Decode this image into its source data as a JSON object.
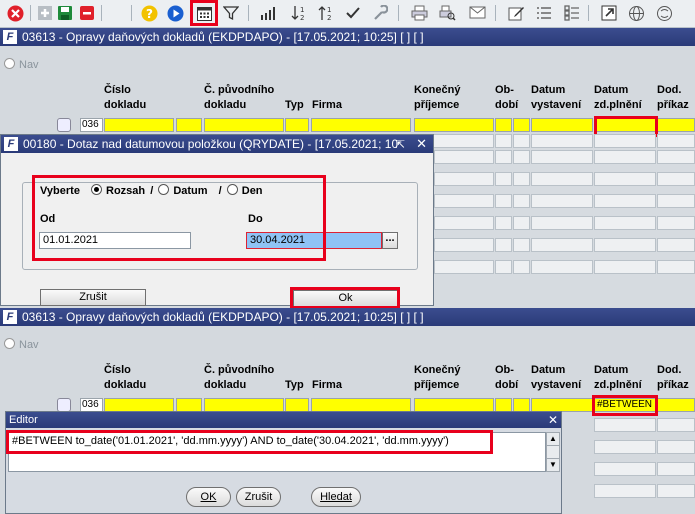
{
  "toolbar": {
    "icons": [
      "close-icon",
      "add-icon",
      "save-icon",
      "delete-icon",
      "help-icon",
      "play-icon",
      "calendar-icon",
      "filter-icon",
      "bar-chart-icon",
      "sort-desc-icon",
      "sort-asc-icon",
      "check-icon",
      "wrench-icon",
      "print-icon",
      "print-preview-icon",
      "mail-icon",
      "edit-icon",
      "list-icon",
      "checklist-icon",
      "export-icon",
      "globe-icon",
      "other-icon"
    ]
  },
  "window_top": {
    "title": "03613 - Opravy daňových dokladů (EKDPDAPO) - [17.05.2021; 10:25] [ ] [ ]",
    "nav": "Nav",
    "row_number": "036",
    "columns": [
      "Číslo\ndokladu",
      "Č. původního\ndokladu",
      "Typ",
      "Firma",
      "Konečný\npříjemce",
      "Ob-\ndobí",
      "Datum\nvystavení",
      "Datum\nzd.plnění",
      "Dod.\npříkaz"
    ]
  },
  "date_dialog": {
    "title": "00180 - Dotaz nad datumovou položkou (QRYDATE) - [17.05.2021; 10",
    "select_label": "Vyberte",
    "radio_range": "Rozsah",
    "radio_date": "Datum",
    "radio_day": "Den",
    "slash": "/",
    "from_label": "Od",
    "from_value": "01.01.2021",
    "to_label": "Do",
    "to_value": "30.04.2021",
    "ellipsis": "...",
    "cancel_label": "Zrušit",
    "ok_label": "Ok"
  },
  "window_bottom": {
    "title": "03613 - Opravy daňových dokladů (EKDPDAPO) - [17.05.2021; 10:25] [ ] [ ]",
    "nav": "Nav",
    "row_number": "036",
    "date_cell_value": "#BETWEEN"
  },
  "editor": {
    "title": "Editor",
    "content": "#BETWEEN to_date('01.01.2021', 'dd.mm.yyyy') AND to_date('30.04.2021', 'dd.mm.yyyy')",
    "ok_label": "OK",
    "cancel_label": "Zrušit",
    "search_label": "Hledat"
  },
  "colors": {
    "highlight": "#e8001c",
    "field_yellow": "#ffff00",
    "title_bar": "#2a3a78"
  }
}
